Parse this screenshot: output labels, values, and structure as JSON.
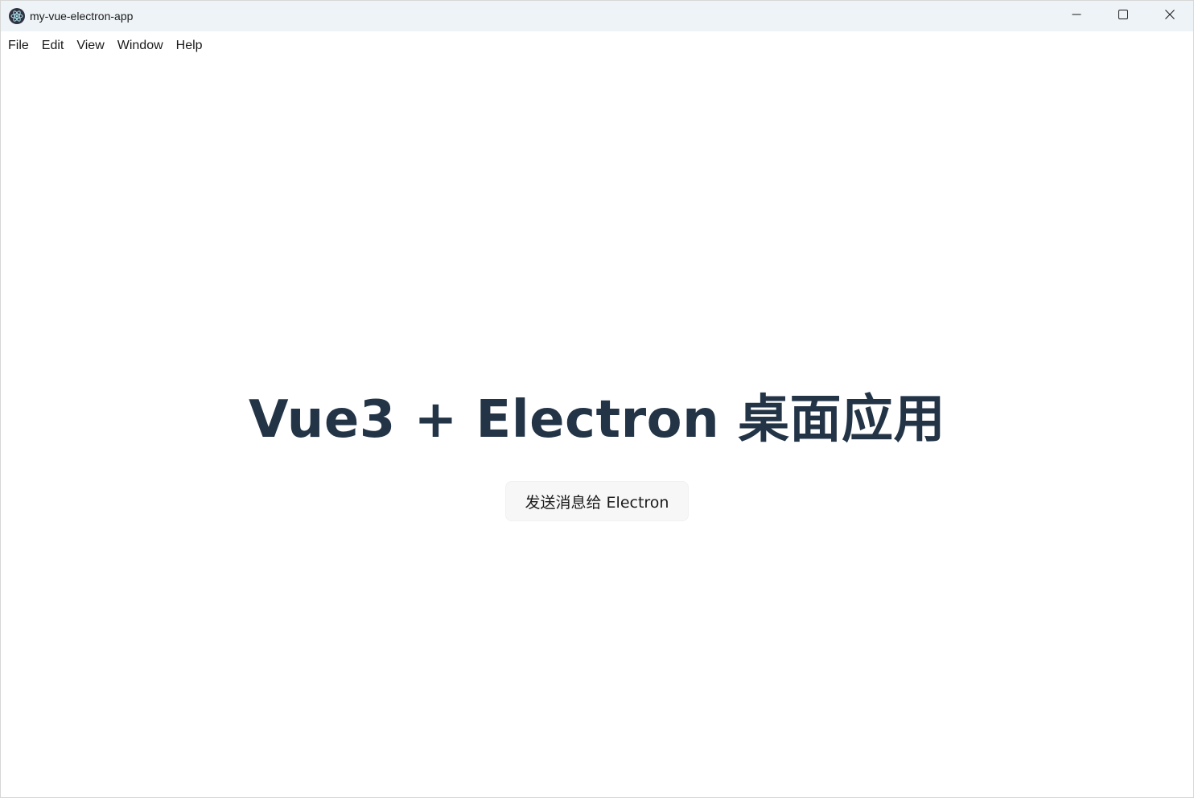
{
  "window": {
    "title": "my-vue-electron-app",
    "app_icon": "electron-logo-icon",
    "controls": [
      "minimize-icon",
      "maximize-icon",
      "close-icon"
    ]
  },
  "menubar": {
    "items": [
      {
        "label": "File"
      },
      {
        "label": "Edit"
      },
      {
        "label": "View"
      },
      {
        "label": "Window"
      },
      {
        "label": "Help"
      }
    ]
  },
  "main": {
    "heading": "Vue3 + Electron 桌面应用",
    "send_button_label": "发送消息给 Electron"
  },
  "colors": {
    "heading": "#233447",
    "titlebar_bg": "#eef3f7",
    "button_bg": "#f7f7f7"
  }
}
